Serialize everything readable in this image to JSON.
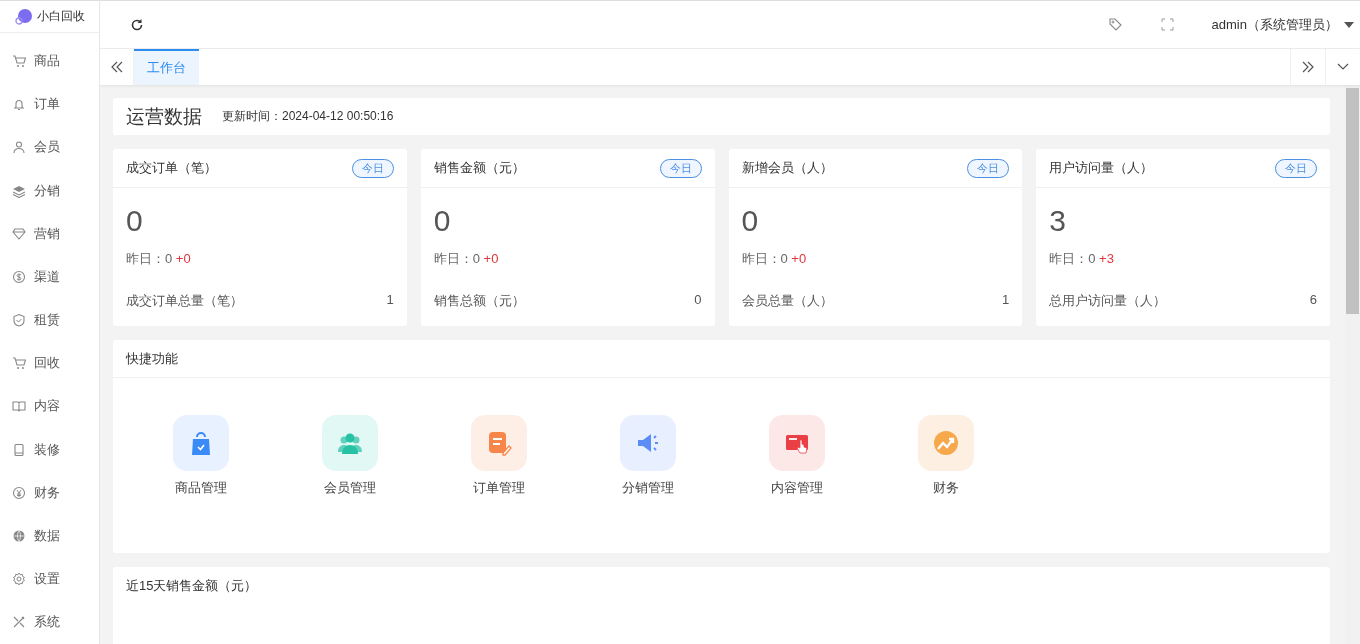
{
  "logo": {
    "text": "小白回收"
  },
  "sidebar": {
    "items": [
      {
        "label": "商品"
      },
      {
        "label": "订单"
      },
      {
        "label": "会员"
      },
      {
        "label": "分销"
      },
      {
        "label": "营销"
      },
      {
        "label": "渠道"
      },
      {
        "label": "租赁"
      },
      {
        "label": "回收"
      },
      {
        "label": "内容"
      },
      {
        "label": "装修"
      },
      {
        "label": "财务"
      },
      {
        "label": "数据"
      },
      {
        "label": "设置"
      },
      {
        "label": "系统"
      }
    ]
  },
  "header": {
    "user": "admin（系统管理员）"
  },
  "tabs": [
    {
      "label": "工作台",
      "selected": true
    }
  ],
  "overview": {
    "title": "运营数据",
    "updated": "更新时间：2024-04-12 00:50:16"
  },
  "stats": [
    {
      "title": "成交订单（笔）",
      "badge": "今日",
      "value": "0",
      "yesterday": "昨日：0",
      "delta": "+0",
      "total_label": "成交订单总量（笔）",
      "total": "1"
    },
    {
      "title": "销售金额（元）",
      "badge": "今日",
      "value": "0",
      "yesterday": "昨日：0",
      "delta": "+0",
      "total_label": "销售总额（元）",
      "total": "0"
    },
    {
      "title": "新增会员（人）",
      "badge": "今日",
      "value": "0",
      "yesterday": "昨日：0",
      "delta": "+0",
      "total_label": "会员总量（人）",
      "total": "1"
    },
    {
      "title": "用户访问量（人）",
      "badge": "今日",
      "value": "3",
      "yesterday": "昨日：0",
      "delta": "+3",
      "total_label": "总用户访问量（人）",
      "total": "6"
    }
  ],
  "quick": {
    "title": "快捷功能",
    "items": [
      {
        "label": "商品管理"
      },
      {
        "label": "会员管理"
      },
      {
        "label": "订单管理"
      },
      {
        "label": "分销管理"
      },
      {
        "label": "内容管理"
      },
      {
        "label": "财务"
      }
    ]
  },
  "sales_chart": {
    "title": "近15天销售金额（元）"
  }
}
